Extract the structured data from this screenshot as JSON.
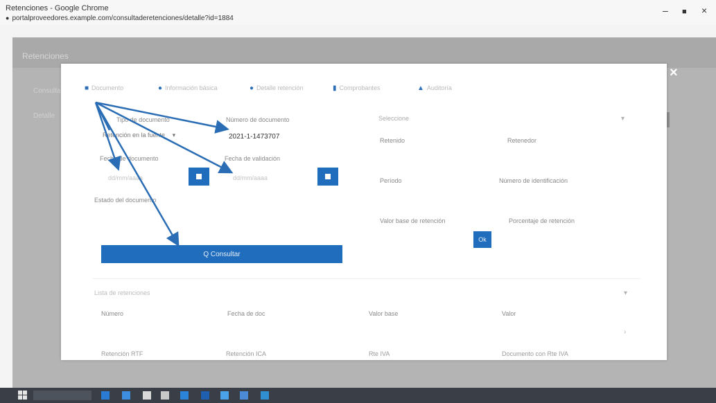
{
  "window": {
    "title": "Retenciones - Google Chrome",
    "url": "portalproveedores.example.com/consultaderetenciones/detalle?id=1884",
    "minimize": "–",
    "maximize": "■",
    "close": "×"
  },
  "page": {
    "header": "Retenciones",
    "side_item_1": "Consultas",
    "side_item_2": "Detalle"
  },
  "modal": {
    "close_label": "×",
    "tabs": [
      {
        "icon": "■",
        "label": "Documento"
      },
      {
        "icon": "●",
        "label": "Información básica"
      },
      {
        "icon": "●",
        "label": "Detalle retención"
      },
      {
        "icon": "▮",
        "label": "Comprobantes"
      },
      {
        "icon": "▲",
        "label": "Auditoría"
      }
    ],
    "form": {
      "tipo_doc_label": "Tipo de documento",
      "tipo_doc_value": "Retención en la fuente",
      "tipo_doc_arrow": "▾",
      "num_doc_label": "Número de documento",
      "num_doc_value": "2021-1-1473707",
      "fecha_label": "Fecha de documento",
      "fecha_placeholder": "dd/mm/aaaa",
      "fecha_valid_label": "Fecha de validación",
      "fecha_valid_placeholder": "dd/mm/aaaa",
      "estado_label": "Estado del documento",
      "search_button": "Q Consultar"
    },
    "right": {
      "select_value": "Seleccione",
      "select_arrow": "▾",
      "f1": "Retenido",
      "f2": "Retenedor",
      "f3": "Período",
      "f4": "Número de identificación",
      "f5": "Valor base de retención",
      "f6": "Porcentaje de retención",
      "small_button": "Ok"
    },
    "bottom": {
      "section_label": "Lista de retenciones",
      "section_arrow": "▾",
      "col1": "Número",
      "col2": "Fecha de doc",
      "col3": "Valor base",
      "col4": "Valor",
      "row1": "Retención RTF",
      "row2": "Retención ICA",
      "row3": "Rte IVA",
      "row4": "Documento con Rte IVA",
      "row_arrow": "›"
    }
  },
  "colors": {
    "accent": "#1f6dbc",
    "arrow": "#2a6db5"
  }
}
